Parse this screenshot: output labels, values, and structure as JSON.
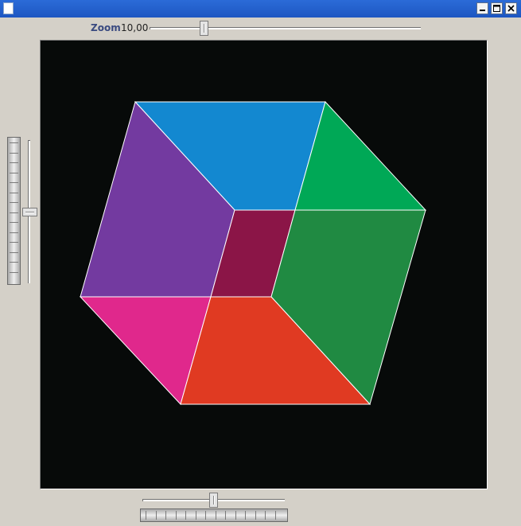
{
  "window": {
    "title": "",
    "icons": {
      "app": "blank-document-icon",
      "minimize": "minimize-icon",
      "maximize": "maximize-icon",
      "close": "close-icon"
    }
  },
  "zoom": {
    "label": "Zoom",
    "value": "10,00",
    "fraction": 0.19
  },
  "rotation": {
    "vertical_slider_fraction": 0.5,
    "horizontal_slider_fraction": 0.5
  },
  "canvas": {
    "background": "#070a09",
    "edge_color": "#ffffff",
    "faces": [
      {
        "name": "top-face",
        "color": "#1388d0"
      },
      {
        "name": "right-top-face",
        "color": "#00a856"
      },
      {
        "name": "left-face",
        "color": "#733aa0"
      },
      {
        "name": "inner-face",
        "color": "#8b1547"
      },
      {
        "name": "right-face",
        "color": "#208a42"
      },
      {
        "name": "bottom-left-face",
        "color": "#e0288c"
      },
      {
        "name": "bottom-face",
        "color": "#e03a22"
      }
    ]
  }
}
